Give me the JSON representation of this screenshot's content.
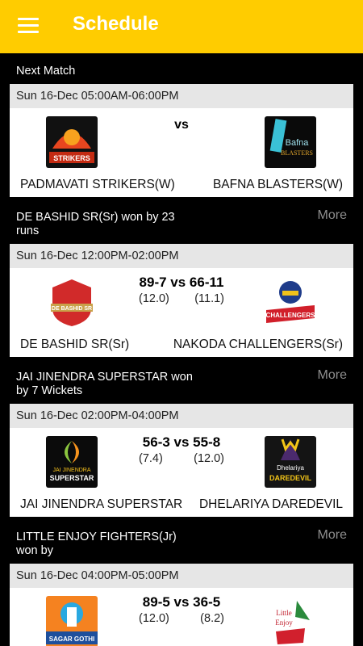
{
  "appbar": {
    "title": "Schedule",
    "menu_icon": "hamburger-menu-icon"
  },
  "matches": [
    {
      "status": "Next Match",
      "more": "",
      "date": "Sun 16-Dec 05:00AM-06:00PM",
      "vs": "vs",
      "score": "",
      "overs1": "",
      "overs2": "",
      "team1": "PADMAVATI STRIKERS(W)",
      "team2": "BAFNA BLASTERS(W)",
      "logo1_text": "PADMAVATI STRIKERS",
      "logo2_text": "Bafna BLASTERS"
    },
    {
      "status": "DE BASHID SR(Sr) won by 23 runs",
      "more": "More",
      "date": "Sun 16-Dec 12:00PM-02:00PM",
      "vs": "",
      "score": "89-7 vs 66-11",
      "overs1": "(12.0)",
      "overs2": "(11.1)",
      "team1": "DE BASHID SR(Sr)",
      "team2": "NAKODA CHALLENGERS(Sr)",
      "logo1_text": "DE BASHID SR",
      "logo2_text": "NAKODA CHALLENGERS"
    },
    {
      "status": "JAI JINENDRA SUPERSTAR won by 7 Wickets",
      "more": "More",
      "date": "Sun 16-Dec 02:00PM-04:00PM",
      "vs": "",
      "score": "56-3 vs 55-8",
      "overs1": "(7.4)",
      "overs2": "(12.0)",
      "team1": "JAI JINENDRA SUPERSTAR",
      "team2": "DHELARIYA DAREDEVIL",
      "logo1_text": "JAI JINENDRA SUPERSTAR",
      "logo2_text": "Dhelariya DAREDEVIL"
    },
    {
      "status": "LITTLE ENJOY FIGHTERS(Jr) won by",
      "more": "More",
      "date": "Sun 16-Dec 04:00PM-05:00PM",
      "vs": "",
      "score": "89-5 vs 36-5",
      "overs1": "(12.0)",
      "overs2": "(8.2)",
      "team1": "",
      "team2": "",
      "logo1_text": "SAGAR GOTHI",
      "logo2_text": "Little Enjoy Fighters"
    }
  ]
}
